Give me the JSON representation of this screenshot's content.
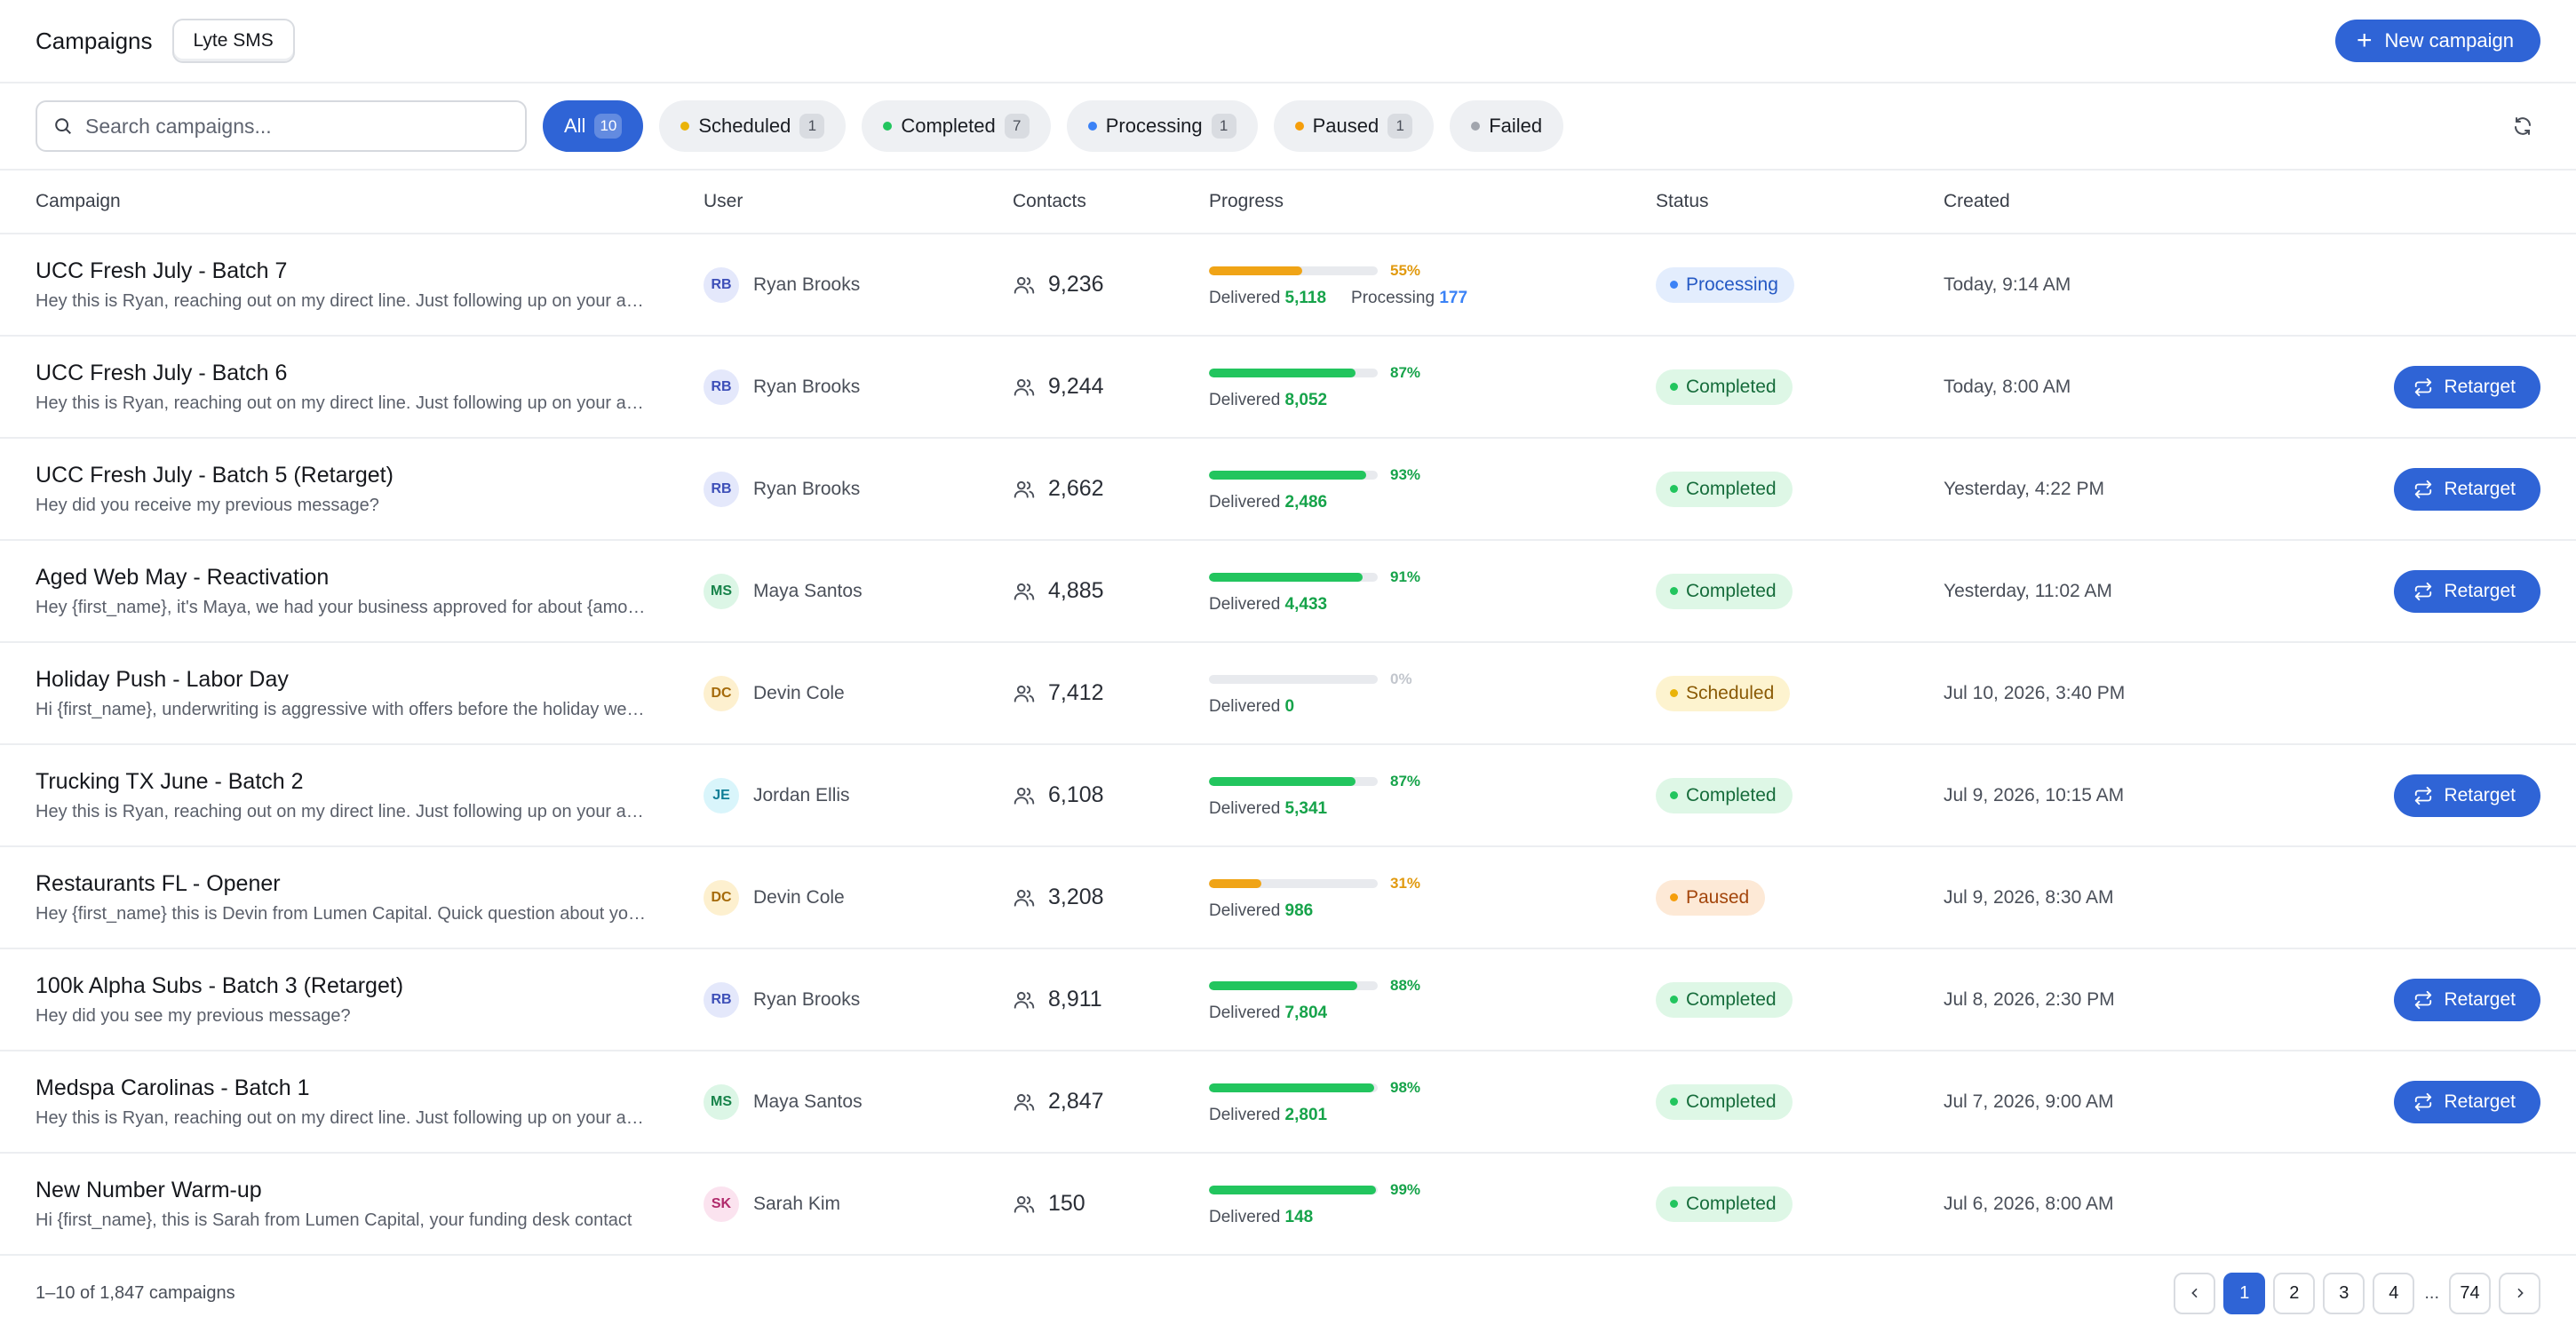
{
  "header": {
    "title": "Campaigns",
    "workspace": "Lyte SMS",
    "new_button": "New campaign"
  },
  "toolbar": {
    "search_placeholder": "Search campaigns...",
    "filters": [
      {
        "label": "All",
        "count": "10",
        "active": true,
        "dot": ""
      },
      {
        "label": "Scheduled",
        "count": "1",
        "active": false,
        "dot": "#eab308"
      },
      {
        "label": "Completed",
        "count": "7",
        "active": false,
        "dot": "#22c55e"
      },
      {
        "label": "Processing",
        "count": "1",
        "active": false,
        "dot": "#3b82f6"
      },
      {
        "label": "Paused",
        "count": "1",
        "active": false,
        "dot": "#f59e0b"
      },
      {
        "label": "Failed",
        "count": "",
        "active": false,
        "dot": "#a1a5ad"
      }
    ]
  },
  "table": {
    "headers": {
      "campaign": "Campaign",
      "user": "User",
      "contacts": "Contacts",
      "progress": "Progress",
      "status": "Status",
      "created": "Created"
    },
    "rows": [
      {
        "name": "UCC Fresh July - Batch 7",
        "message": "Hey this is Ryan, reaching out on my direct line. Just following up on your application",
        "initials": "RB",
        "user": "Ryan Brooks",
        "avatar": "blue",
        "contacts": "9,236",
        "progress": 0.55,
        "pct": "55%",
        "bar": "orange",
        "delivered_label": "Delivered",
        "delivered": "5,118",
        "processing_label": "Processing",
        "processing": "177",
        "status": "Processing",
        "status_kind": "processing",
        "created": "Today, 9:14 AM",
        "action": ""
      },
      {
        "name": "UCC Fresh July - Batch 6",
        "message": "Hey this is Ryan, reaching out on my direct line. Just following up on your application",
        "initials": "RB",
        "user": "Ryan Brooks",
        "avatar": "blue",
        "contacts": "9,244",
        "progress": 0.87,
        "pct": "87%",
        "bar": "green",
        "delivered_label": "Delivered",
        "delivered": "8,052",
        "processing_label": "",
        "processing": "",
        "status": "Completed",
        "status_kind": "completed",
        "created": "Today, 8:00 AM",
        "action": "Retarget"
      },
      {
        "name": "UCC Fresh July - Batch 5 (Retarget)",
        "message": "Hey did you receive my previous message?",
        "initials": "RB",
        "user": "Ryan Brooks",
        "avatar": "blue",
        "contacts": "2,662",
        "progress": 0.93,
        "pct": "93%",
        "bar": "green",
        "delivered_label": "Delivered",
        "delivered": "2,486",
        "processing_label": "",
        "processing": "",
        "status": "Completed",
        "status_kind": "completed",
        "created": "Yesterday, 4:22 PM",
        "action": "Retarget"
      },
      {
        "name": "Aged Web May - Reactivation",
        "message": "Hey {first_name}, it's Maya, we had your business approved for about {amount}",
        "initials": "MS",
        "user": "Maya Santos",
        "avatar": "green",
        "contacts": "4,885",
        "progress": 0.91,
        "pct": "91%",
        "bar": "green",
        "delivered_label": "Delivered",
        "delivered": "4,433",
        "processing_label": "",
        "processing": "",
        "status": "Completed",
        "status_kind": "completed",
        "created": "Yesterday, 11:02 AM",
        "action": "Retarget"
      },
      {
        "name": "Holiday Push - Labor Day",
        "message": "Hi {first_name}, underwriting is aggressive with offers before the holiday weekend",
        "initials": "DC",
        "user": "Devin Cole",
        "avatar": "amber",
        "contacts": "7,412",
        "progress": 0,
        "pct": "0%",
        "bar": "grey",
        "delivered_label": "Delivered",
        "delivered": "0",
        "processing_label": "",
        "processing": "",
        "status": "Scheduled",
        "status_kind": "scheduled",
        "created": "Jul 10, 2026, 3:40 PM",
        "action": ""
      },
      {
        "name": "Trucking TX June - Batch 2",
        "message": "Hey this is Ryan, reaching out on my direct line. Just following up on your application",
        "initials": "JE",
        "user": "Jordan Ellis",
        "avatar": "cyan",
        "contacts": "6,108",
        "progress": 0.87,
        "pct": "87%",
        "bar": "green",
        "delivered_label": "Delivered",
        "delivered": "5,341",
        "processing_label": "",
        "processing": "",
        "status": "Completed",
        "status_kind": "completed",
        "created": "Jul 9, 2026, 10:15 AM",
        "action": "Retarget"
      },
      {
        "name": "Restaurants FL - Opener",
        "message": "Hey {first_name} this is Devin from Lumen Capital. Quick question about your funding",
        "initials": "DC",
        "user": "Devin Cole",
        "avatar": "amber",
        "contacts": "3,208",
        "progress": 0.31,
        "pct": "31%",
        "bar": "orange",
        "delivered_label": "Delivered",
        "delivered": "986",
        "processing_label": "",
        "processing": "",
        "status": "Paused",
        "status_kind": "paused",
        "created": "Jul 9, 2026, 8:30 AM",
        "action": ""
      },
      {
        "name": "100k Alpha Subs - Batch 3 (Retarget)",
        "message": "Hey did you see my previous message?",
        "initials": "RB",
        "user": "Ryan Brooks",
        "avatar": "blue",
        "contacts": "8,911",
        "progress": 0.88,
        "pct": "88%",
        "bar": "green",
        "delivered_label": "Delivered",
        "delivered": "7,804",
        "processing_label": "",
        "processing": "",
        "status": "Completed",
        "status_kind": "completed",
        "created": "Jul 8, 2026, 2:30 PM",
        "action": "Retarget"
      },
      {
        "name": "Medspa Carolinas - Batch 1",
        "message": "Hey this is Ryan, reaching out on my direct line. Just following up on your application",
        "initials": "MS",
        "user": "Maya Santos",
        "avatar": "green",
        "contacts": "2,847",
        "progress": 0.98,
        "pct": "98%",
        "bar": "green",
        "delivered_label": "Delivered",
        "delivered": "2,801",
        "processing_label": "",
        "processing": "",
        "status": "Completed",
        "status_kind": "completed",
        "created": "Jul 7, 2026, 9:00 AM",
        "action": "Retarget"
      },
      {
        "name": "New Number Warm-up",
        "message": "Hi {first_name}, this is Sarah from Lumen Capital, your funding desk contact",
        "initials": "SK",
        "user": "Sarah Kim",
        "avatar": "pink",
        "contacts": "150",
        "progress": 0.99,
        "pct": "99%",
        "bar": "green",
        "delivered_label": "Delivered",
        "delivered": "148",
        "processing_label": "",
        "processing": "",
        "status": "Completed",
        "status_kind": "completed",
        "created": "Jul 6, 2026, 8:00 AM",
        "action": ""
      }
    ]
  },
  "footer": {
    "summary": "1–10 of 1,847 campaigns",
    "pages": [
      "1",
      "2",
      "3",
      "4"
    ],
    "ellipsis": "...",
    "last_page": "74",
    "current_page": "1"
  },
  "colors": {
    "accent": "#2f64d6",
    "green": "#22c55e",
    "orange": "#f0a416",
    "blue": "#3b82f6"
  }
}
